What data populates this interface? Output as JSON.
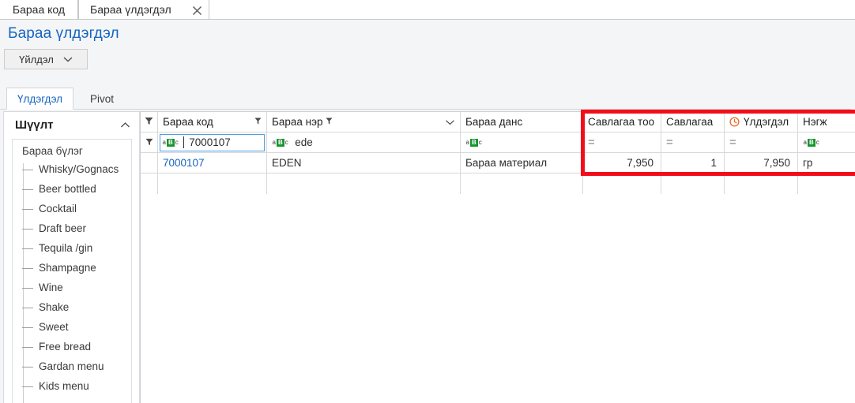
{
  "window": {
    "tabs": [
      {
        "label": "Бараа код",
        "active": false,
        "closable": false
      },
      {
        "label": "Бараа үлдэгдэл",
        "active": true,
        "closable": true
      }
    ],
    "close_icon": "close-icon",
    "close_glyph": "✕"
  },
  "page": {
    "title": "Бараа үлдэгдэл"
  },
  "toolbar": {
    "action_label": "Үйлдэл",
    "action_caret_icon": "chevron-down-icon"
  },
  "subtabs": [
    {
      "label": "Үлдэгдэл",
      "active": true
    },
    {
      "label": "Pivot",
      "active": false
    }
  ],
  "sidebar": {
    "title": "Шүүлт",
    "collapse_icon": "chevron-up-icon",
    "root_label": "Бараа бүлэг",
    "items": [
      {
        "label": "Whisky/Gognacs"
      },
      {
        "label": "Beer bottled"
      },
      {
        "label": "Cocktail"
      },
      {
        "label": "Draft beer"
      },
      {
        "label": "Tequila /gin"
      },
      {
        "label": "Shampagne"
      },
      {
        "label": "Wine"
      },
      {
        "label": "Shake"
      },
      {
        "label": "Sweet"
      },
      {
        "label": "Free bread"
      },
      {
        "label": "Gardan menu"
      },
      {
        "label": "Kids menu"
      }
    ]
  },
  "grid": {
    "columns": [
      {
        "key": "flag",
        "label": "",
        "icon": "funnel-icon",
        "align": "center",
        "has_funnel_badge": false
      },
      {
        "key": "code",
        "label": "Бараа код",
        "icon": "funnel-small-icon",
        "align": "left",
        "has_funnel_badge": true
      },
      {
        "key": "name",
        "label": "Бараа нэр",
        "icon": "funnel-small-icon",
        "align": "left",
        "has_funnel_badge": true,
        "has_chevron": true
      },
      {
        "key": "acct",
        "label": "Бараа данс",
        "icon": "",
        "align": "left",
        "has_funnel_badge": false
      },
      {
        "key": "pkgn",
        "label": "Савлагаа тоо",
        "icon": "",
        "align": "left",
        "has_funnel_badge": false
      },
      {
        "key": "pkg",
        "label": "Савлагаа",
        "icon": "",
        "align": "left",
        "has_funnel_badge": false
      },
      {
        "key": "rest",
        "label": "Үлдэгдэл",
        "icon": "clock-icon",
        "align": "left",
        "has_funnel_badge": false
      },
      {
        "key": "unit",
        "label": "Нэгж",
        "icon": "",
        "align": "left",
        "has_funnel_badge": false
      }
    ],
    "filter_row": {
      "flag_icon": "funnel-icon",
      "code": {
        "type": "abc",
        "value": "7000107",
        "focused": true
      },
      "name": {
        "type": "abc",
        "value": "ede",
        "focused": false
      },
      "acct": {
        "type": "abc",
        "value": "",
        "focused": false
      },
      "pkgn": {
        "type": "equals",
        "value": "=",
        "focused": false
      },
      "pkg": {
        "type": "equals",
        "value": "=",
        "focused": false
      },
      "rest": {
        "type": "equals",
        "value": "=",
        "focused": false
      },
      "unit": {
        "type": "abc",
        "value": "",
        "focused": false
      }
    },
    "rows": [
      {
        "code": "7000107",
        "name": "EDEN",
        "acct": "Бараа материал",
        "pkgn": "7,950",
        "pkg": "1",
        "rest": "7,950",
        "unit": "гр"
      }
    ]
  },
  "annotation": {
    "highlight_color": "#f20d1a",
    "highlight_name": "red-highlight-box"
  },
  "colors": {
    "accent_blue": "#1565c0",
    "link_blue": "#1565c0",
    "clock_orange": "#f26522",
    "abc_green": "#17962f",
    "border_gray": "#d6d8db",
    "page_bg": "#f4f5f7"
  }
}
